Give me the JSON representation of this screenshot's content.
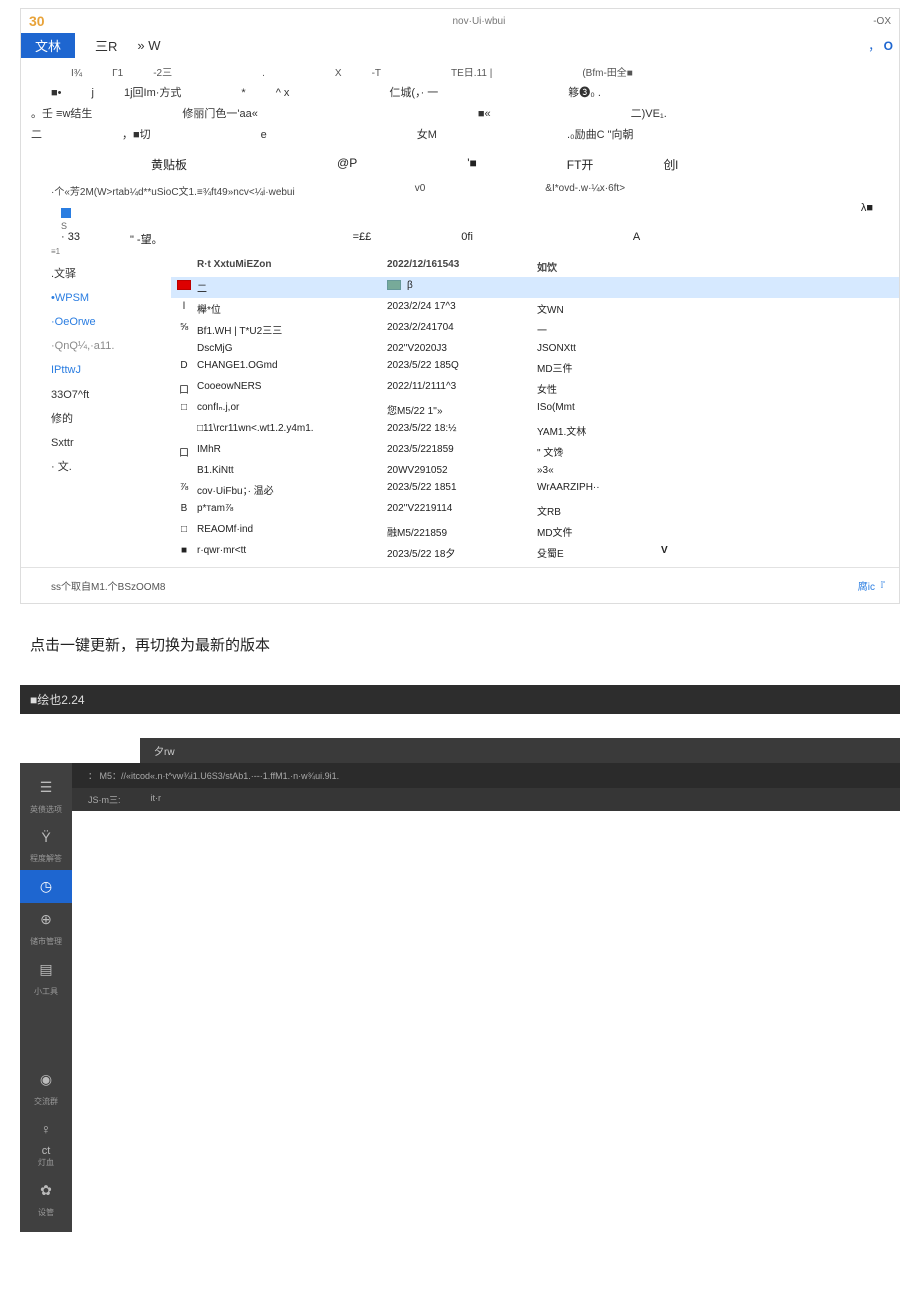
{
  "win1": {
    "num": "30",
    "crumb": "nov·Ui·wbui",
    "wctl": "-OX",
    "tab_active": "文林",
    "tab2a": "三R",
    "tab2b": "» W",
    "refresh_a": "，",
    "refresh_b": "O",
    "tb_row1": [
      "I¾",
      "Γ1",
      "-2三",
      ".",
      "X",
      "-T",
      "TE日.11 |",
      "(Bfm-田全■"
    ],
    "tb_row2": [
      "■•",
      "j",
      "1j回Im·方式",
      "*",
      "^ x",
      "仁城(，· 一",
      "簃❸₀ ."
    ],
    "tb_row3": [
      "。壬 ≡w结生",
      "修丽门色一'aa«",
      "■«",
      "二)VE₁."
    ],
    "tb_row4": [
      "二",
      "，■切",
      "e",
      "女M",
      ".₀励曲C \"向朝"
    ],
    "quick": [
      "黄贴板",
      "@P",
      "'■",
      "FT开",
      "创l"
    ],
    "path_l": "·个«芳2M(W>rtab¼d**uSioC文1.≡¾ft49»ncv<¼i·webui",
    "path_m": "v0",
    "path_r": "&I*ovd-.w·¼x·6ft>",
    "lambda": "λ■",
    "sub_row": [
      "· 33",
      "\" -望。",
      "=££",
      "0fi",
      "A"
    ],
    "s_mark": "S",
    "eq1": "≡1",
    "sidebar": [
      {
        "t": ".文驿",
        "c": "item"
      },
      {
        "t": "•WPSM",
        "c": "item blue"
      },
      {
        "t": "",
        "c": "item"
      },
      {
        "t": "·OeOrwe",
        "c": "item blue"
      },
      {
        "t": "·QnQ¼,·a11.",
        "c": "item gray"
      },
      {
        "t": "",
        "c": "item"
      },
      {
        "t": "IPttwJ",
        "c": "item blue"
      },
      {
        "t": "33O7^ft",
        "c": "item"
      },
      {
        "t": "修的",
        "c": "item"
      },
      {
        "t": "Sxttr",
        "c": "item"
      },
      {
        "t": "· 文.",
        "c": "item"
      }
    ],
    "hdr": {
      "name": "R·t            XxtuMiEZon",
      "date": "2022/12/161543",
      "type": "如饮"
    },
    "selrow": {
      "name": "二",
      "beta": "β"
    },
    "rows": [
      {
        "ic": "l",
        "name": "櫸*位",
        "date": "2023/2/24   17^3",
        "type": "文WN"
      },
      {
        "ic": "⅝",
        "name": "Bf1.WH | T*U2三三",
        "date": "2023/2/241704",
        "type": "一"
      },
      {
        "ic": "",
        "name": "DscMjG",
        "date": "202''V2020J3",
        "type": "JSONXtt"
      },
      {
        "ic": "D",
        "name": "CHANGE1.OGmd",
        "date": "2023/5/22    185Q",
        "type": "MD三件"
      },
      {
        "ic": "口",
        "name": "CooeowNERS",
        "date": "2022/11/2111^3",
        "type": "女性"
      },
      {
        "ic": "□",
        "name": "confIₙ.j,or",
        "date": "您M5/22   1''»",
        "type": "ISo(Mmt"
      },
      {
        "ic": "",
        "name": "□11\\rcr11wn<.wt1.2.y4m1.",
        "date": "2023/5/22   18:½",
        "type": "YAM1.文林"
      },
      {
        "ic": "口",
        "name": "IMhR",
        "date": "2023/5/221859",
        "type": "\" 文馋"
      },
      {
        "ic": "",
        "name": "B1.KiNtt",
        "date": "20WV291052",
        "type": "»3«"
      },
      {
        "ic": "⅞",
        "name": "cov·UiFbu；· 温必",
        "date": "2023/5/22     1851",
        "type": "WrAARZIPH··"
      },
      {
        "ic": "B",
        "name": "p*тam⅞",
        "date": "202''V2219114",
        "type": "文RB"
      },
      {
        "ic": "□",
        "name": "REAOMf·ind",
        "date": "融M5/221859",
        "type": "MD文件"
      },
      {
        "ic": "■",
        "name": "r·qwr·mr<tt",
        "date": "2023/5/22   18夕",
        "type": "殳蜀E"
      }
    ],
    "row_tail": "V",
    "status_l": "ss个取自M1.个BSzOOM8",
    "status_r": "腐ic『"
  },
  "instr": "点击一键更新，再切换为最新的版本",
  "win2": {
    "title": "■绘也2.24",
    "sub": "夕rw",
    "bar1": "：  M5：//«itcod«.n·t^vw¾i1.U6S3/stAb1.·--·1.ffM1.·n·w¾ui.9i1.",
    "bar2a": "JS·m三:",
    "bar2b": "it·r",
    "side": [
      {
        "ic": "☰",
        "lbl": "英债选项"
      },
      {
        "ic": "Ϋ",
        "lbl": "程度解答"
      },
      {
        "ic": "◷",
        "lbl": "",
        "sel": true
      },
      {
        "ic": "⊕",
        "lbl": "储市管理"
      },
      {
        "ic": "▤",
        "lbl": "小工具"
      },
      {
        "gap": true
      },
      {
        "ic": "◉",
        "lbl": "交流群"
      },
      {
        "ic": "♀",
        "lbl": "灯血"
      },
      {
        "ic": "✿",
        "lbl": "设管"
      }
    ]
  }
}
